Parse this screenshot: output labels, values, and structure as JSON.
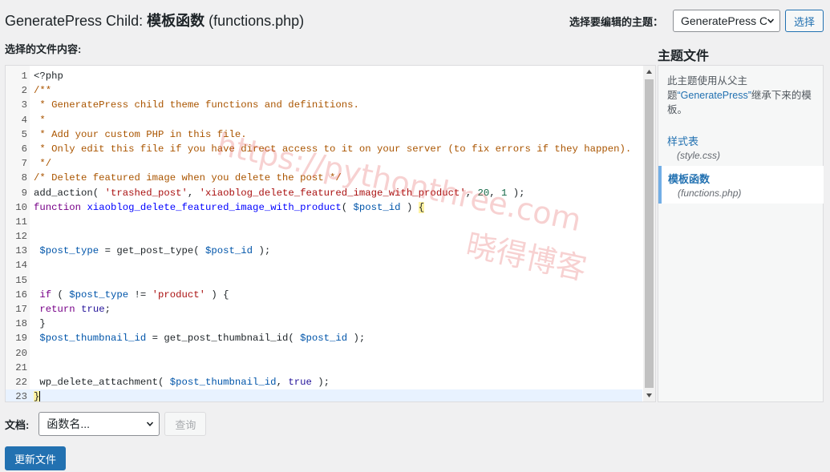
{
  "page": {
    "title_theme": "GeneratePress Child: ",
    "title_file": "模板函数",
    "title_filename": " (functions.php)"
  },
  "theme_selector": {
    "label": "选择要编辑的主题：",
    "selected": "GeneratePress Child",
    "button": "选择"
  },
  "editor": {
    "label": "选择的文件内容:"
  },
  "watermark": {
    "line1": "https://pythonthree.com",
    "line2": "晓得博客"
  },
  "files": {
    "title": "主题文件",
    "note_prefix": "此主题使用从父主题",
    "note_parent": "“GeneratePress”",
    "note_suffix": "继承下来的模板。",
    "items": [
      {
        "name": "样式表",
        "file": "(style.css)",
        "current": false
      },
      {
        "name": "模板函数",
        "file": "(functions.php)",
        "current": true
      }
    ]
  },
  "documentation": {
    "label": "文档:",
    "select_placeholder": "函数名...",
    "lookup_button": "查询"
  },
  "update_button": "更新文件",
  "icons": {
    "theme_select_chevron": "chevron-down-icon",
    "docs_select_chevron": "chevron-down-icon",
    "scroll_up": "triangle-up-icon",
    "scroll_down": "triangle-down-icon"
  },
  "code_lines": [
    [
      {
        "t": "plain",
        "s": "<?php"
      }
    ],
    [
      {
        "t": "com",
        "s": "/**"
      }
    ],
    [
      {
        "t": "com",
        "s": " * GeneratePress child theme functions and definitions."
      }
    ],
    [
      {
        "t": "com",
        "s": " *"
      }
    ],
    [
      {
        "t": "com",
        "s": " * Add your custom PHP in this file."
      }
    ],
    [
      {
        "t": "com",
        "s": " * Only edit this file if you have direct access to it on your server (to fix errors if they happen)."
      }
    ],
    [
      {
        "t": "com",
        "s": " */"
      }
    ],
    [
      {
        "t": "com",
        "s": "/* Delete featured image when you delete the post */"
      }
    ],
    [
      {
        "t": "plain",
        "s": "add_action( "
      },
      {
        "t": "str",
        "s": "'trashed_post'"
      },
      {
        "t": "plain",
        "s": ", "
      },
      {
        "t": "str",
        "s": "'xiaoblog_delete_featured_image_with_product'"
      },
      {
        "t": "plain",
        "s": ", "
      },
      {
        "t": "num",
        "s": "20"
      },
      {
        "t": "plain",
        "s": ", "
      },
      {
        "t": "num",
        "s": "1"
      },
      {
        "t": "plain",
        "s": " );"
      }
    ],
    [
      {
        "t": "kw",
        "s": "function"
      },
      {
        "t": "plain",
        "s": " "
      },
      {
        "t": "def",
        "s": "xiaoblog_delete_featured_image_with_product"
      },
      {
        "t": "plain",
        "s": "( "
      },
      {
        "t": "var",
        "s": "$post_id"
      },
      {
        "t": "plain",
        "s": " ) "
      },
      {
        "t": "bracket",
        "s": "{"
      }
    ],
    [],
    [],
    [
      {
        "t": "plain",
        "s": " "
      },
      {
        "t": "var",
        "s": "$post_type"
      },
      {
        "t": "plain",
        "s": " = get_post_type( "
      },
      {
        "t": "var",
        "s": "$post_id"
      },
      {
        "t": "plain",
        "s": " );"
      }
    ],
    [],
    [],
    [
      {
        "t": "plain",
        "s": " "
      },
      {
        "t": "kw",
        "s": "if"
      },
      {
        "t": "plain",
        "s": " ( "
      },
      {
        "t": "var",
        "s": "$post_type"
      },
      {
        "t": "plain",
        "s": " != "
      },
      {
        "t": "str",
        "s": "'product'"
      },
      {
        "t": "plain",
        "s": " ) {"
      }
    ],
    [
      {
        "t": "plain",
        "s": " "
      },
      {
        "t": "kw",
        "s": "return"
      },
      {
        "t": "plain",
        "s": " "
      },
      {
        "t": "atom",
        "s": "true"
      },
      {
        "t": "plain",
        "s": ";"
      }
    ],
    [
      {
        "t": "plain",
        "s": " }"
      }
    ],
    [
      {
        "t": "plain",
        "s": " "
      },
      {
        "t": "var",
        "s": "$post_thumbnail_id"
      },
      {
        "t": "plain",
        "s": " = get_post_thumbnail_id( "
      },
      {
        "t": "var",
        "s": "$post_id"
      },
      {
        "t": "plain",
        "s": " );"
      }
    ],
    [],
    [],
    [
      {
        "t": "plain",
        "s": " wp_delete_attachment( "
      },
      {
        "t": "var",
        "s": "$post_thumbnail_id"
      },
      {
        "t": "plain",
        "s": ", "
      },
      {
        "t": "atom",
        "s": "true"
      },
      {
        "t": "plain",
        "s": " );"
      }
    ],
    [
      {
        "t": "bracket",
        "s": "}"
      },
      {
        "t": "cursor",
        "s": ""
      }
    ]
  ],
  "active_line": 23
}
